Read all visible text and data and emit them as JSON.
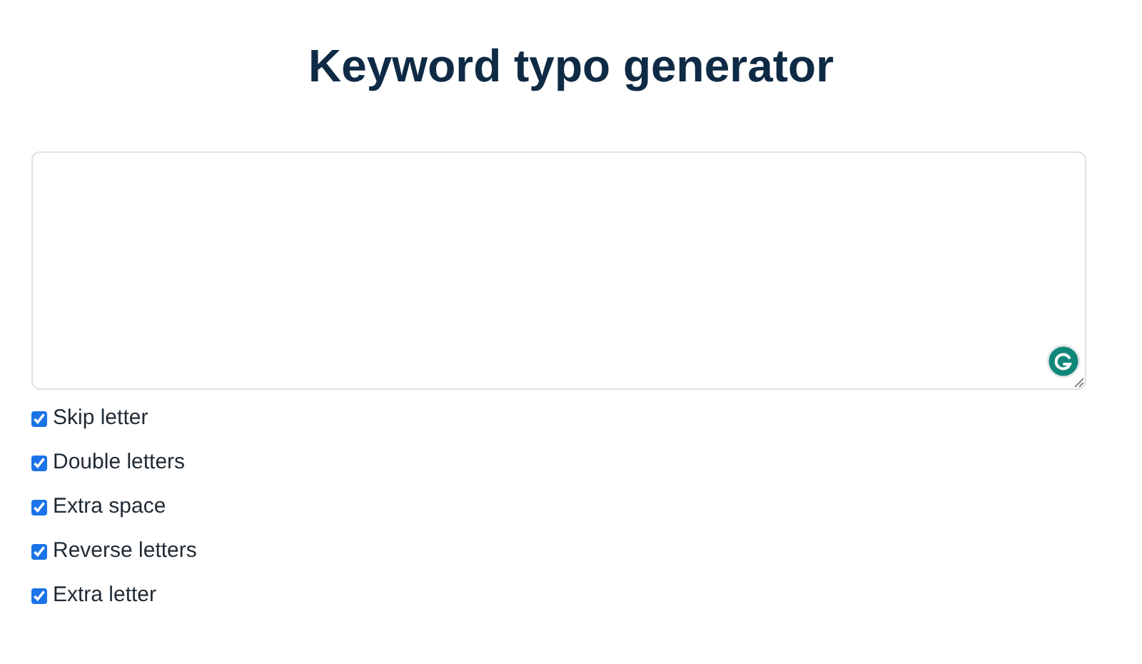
{
  "title": "Keyword typo generator",
  "options": [
    {
      "label": "Skip letter",
      "checked": true
    },
    {
      "label": "Double letters",
      "checked": true
    },
    {
      "label": "Extra space",
      "checked": true
    },
    {
      "label": "Reverse letters",
      "checked": true
    },
    {
      "label": "Extra letter",
      "checked": true
    }
  ]
}
